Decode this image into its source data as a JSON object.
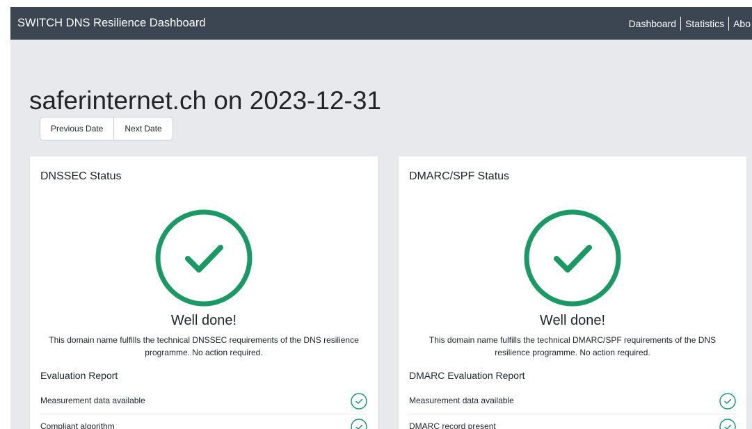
{
  "navbar": {
    "brand": "SWITCH DNS Resilience Dashboard",
    "links": [
      "Dashboard",
      "Statistics",
      "Abo"
    ]
  },
  "header": {
    "title": "saferinternet.ch on 2023-12-31",
    "prev_label": "Previous Date",
    "next_label": "Next Date"
  },
  "cards": [
    {
      "title": "DNSSEC Status",
      "headline": "Well done!",
      "description": "This domain name fulfills the technical DNSSEC requirements of the DNS resilience programme. No action required.",
      "report_title": "Evaluation Report",
      "items": [
        "Measurement data available",
        "Compliant algorithm"
      ]
    },
    {
      "title": "DMARC/SPF Status",
      "headline": "Well done!",
      "description": "This domain name fulfills the technical DMARC/SPF requirements of the DNS resilience programme. No action required.",
      "report_title": "DMARC Evaluation Report",
      "items": [
        "Measurement data available",
        "DMARC record present"
      ]
    }
  ],
  "colors": {
    "success": "#1a9966",
    "navbar": "#3c4652",
    "background": "#e7e9ec"
  },
  "icons": {
    "status": "check-circle-icon"
  }
}
